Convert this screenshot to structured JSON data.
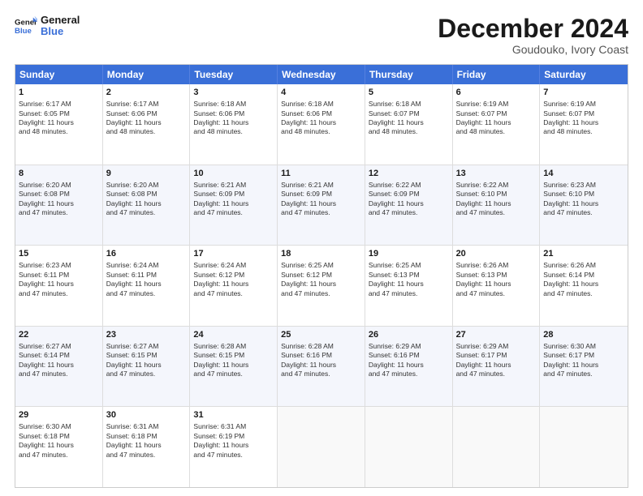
{
  "logo": {
    "line1": "General",
    "line2": "Blue"
  },
  "title": "December 2024",
  "subtitle": "Goudouko, Ivory Coast",
  "header_days": [
    "Sunday",
    "Monday",
    "Tuesday",
    "Wednesday",
    "Thursday",
    "Friday",
    "Saturday"
  ],
  "rows": [
    [
      {
        "day": "1",
        "lines": [
          "Sunrise: 6:17 AM",
          "Sunset: 6:05 PM",
          "Daylight: 11 hours",
          "and 48 minutes."
        ]
      },
      {
        "day": "2",
        "lines": [
          "Sunrise: 6:17 AM",
          "Sunset: 6:06 PM",
          "Daylight: 11 hours",
          "and 48 minutes."
        ]
      },
      {
        "day": "3",
        "lines": [
          "Sunrise: 6:18 AM",
          "Sunset: 6:06 PM",
          "Daylight: 11 hours",
          "and 48 minutes."
        ]
      },
      {
        "day": "4",
        "lines": [
          "Sunrise: 6:18 AM",
          "Sunset: 6:06 PM",
          "Daylight: 11 hours",
          "and 48 minutes."
        ]
      },
      {
        "day": "5",
        "lines": [
          "Sunrise: 6:18 AM",
          "Sunset: 6:07 PM",
          "Daylight: 11 hours",
          "and 48 minutes."
        ]
      },
      {
        "day": "6",
        "lines": [
          "Sunrise: 6:19 AM",
          "Sunset: 6:07 PM",
          "Daylight: 11 hours",
          "and 48 minutes."
        ]
      },
      {
        "day": "7",
        "lines": [
          "Sunrise: 6:19 AM",
          "Sunset: 6:07 PM",
          "Daylight: 11 hours",
          "and 48 minutes."
        ]
      }
    ],
    [
      {
        "day": "8",
        "lines": [
          "Sunrise: 6:20 AM",
          "Sunset: 6:08 PM",
          "Daylight: 11 hours",
          "and 47 minutes."
        ]
      },
      {
        "day": "9",
        "lines": [
          "Sunrise: 6:20 AM",
          "Sunset: 6:08 PM",
          "Daylight: 11 hours",
          "and 47 minutes."
        ]
      },
      {
        "day": "10",
        "lines": [
          "Sunrise: 6:21 AM",
          "Sunset: 6:09 PM",
          "Daylight: 11 hours",
          "and 47 minutes."
        ]
      },
      {
        "day": "11",
        "lines": [
          "Sunrise: 6:21 AM",
          "Sunset: 6:09 PM",
          "Daylight: 11 hours",
          "and 47 minutes."
        ]
      },
      {
        "day": "12",
        "lines": [
          "Sunrise: 6:22 AM",
          "Sunset: 6:09 PM",
          "Daylight: 11 hours",
          "and 47 minutes."
        ]
      },
      {
        "day": "13",
        "lines": [
          "Sunrise: 6:22 AM",
          "Sunset: 6:10 PM",
          "Daylight: 11 hours",
          "and 47 minutes."
        ]
      },
      {
        "day": "14",
        "lines": [
          "Sunrise: 6:23 AM",
          "Sunset: 6:10 PM",
          "Daylight: 11 hours",
          "and 47 minutes."
        ]
      }
    ],
    [
      {
        "day": "15",
        "lines": [
          "Sunrise: 6:23 AM",
          "Sunset: 6:11 PM",
          "Daylight: 11 hours",
          "and 47 minutes."
        ]
      },
      {
        "day": "16",
        "lines": [
          "Sunrise: 6:24 AM",
          "Sunset: 6:11 PM",
          "Daylight: 11 hours",
          "and 47 minutes."
        ]
      },
      {
        "day": "17",
        "lines": [
          "Sunrise: 6:24 AM",
          "Sunset: 6:12 PM",
          "Daylight: 11 hours",
          "and 47 minutes."
        ]
      },
      {
        "day": "18",
        "lines": [
          "Sunrise: 6:25 AM",
          "Sunset: 6:12 PM",
          "Daylight: 11 hours",
          "and 47 minutes."
        ]
      },
      {
        "day": "19",
        "lines": [
          "Sunrise: 6:25 AM",
          "Sunset: 6:13 PM",
          "Daylight: 11 hours",
          "and 47 minutes."
        ]
      },
      {
        "day": "20",
        "lines": [
          "Sunrise: 6:26 AM",
          "Sunset: 6:13 PM",
          "Daylight: 11 hours",
          "and 47 minutes."
        ]
      },
      {
        "day": "21",
        "lines": [
          "Sunrise: 6:26 AM",
          "Sunset: 6:14 PM",
          "Daylight: 11 hours",
          "and 47 minutes."
        ]
      }
    ],
    [
      {
        "day": "22",
        "lines": [
          "Sunrise: 6:27 AM",
          "Sunset: 6:14 PM",
          "Daylight: 11 hours",
          "and 47 minutes."
        ]
      },
      {
        "day": "23",
        "lines": [
          "Sunrise: 6:27 AM",
          "Sunset: 6:15 PM",
          "Daylight: 11 hours",
          "and 47 minutes."
        ]
      },
      {
        "day": "24",
        "lines": [
          "Sunrise: 6:28 AM",
          "Sunset: 6:15 PM",
          "Daylight: 11 hours",
          "and 47 minutes."
        ]
      },
      {
        "day": "25",
        "lines": [
          "Sunrise: 6:28 AM",
          "Sunset: 6:16 PM",
          "Daylight: 11 hours",
          "and 47 minutes."
        ]
      },
      {
        "day": "26",
        "lines": [
          "Sunrise: 6:29 AM",
          "Sunset: 6:16 PM",
          "Daylight: 11 hours",
          "and 47 minutes."
        ]
      },
      {
        "day": "27",
        "lines": [
          "Sunrise: 6:29 AM",
          "Sunset: 6:17 PM",
          "Daylight: 11 hours",
          "and 47 minutes."
        ]
      },
      {
        "day": "28",
        "lines": [
          "Sunrise: 6:30 AM",
          "Sunset: 6:17 PM",
          "Daylight: 11 hours",
          "and 47 minutes."
        ]
      }
    ],
    [
      {
        "day": "29",
        "lines": [
          "Sunrise: 6:30 AM",
          "Sunset: 6:18 PM",
          "Daylight: 11 hours",
          "and 47 minutes."
        ]
      },
      {
        "day": "30",
        "lines": [
          "Sunrise: 6:31 AM",
          "Sunset: 6:18 PM",
          "Daylight: 11 hours",
          "and 47 minutes."
        ]
      },
      {
        "day": "31",
        "lines": [
          "Sunrise: 6:31 AM",
          "Sunset: 6:19 PM",
          "Daylight: 11 hours",
          "and 47 minutes."
        ]
      },
      {
        "day": "",
        "lines": []
      },
      {
        "day": "",
        "lines": []
      },
      {
        "day": "",
        "lines": []
      },
      {
        "day": "",
        "lines": []
      }
    ]
  ],
  "accent_color": "#3a6fd8"
}
